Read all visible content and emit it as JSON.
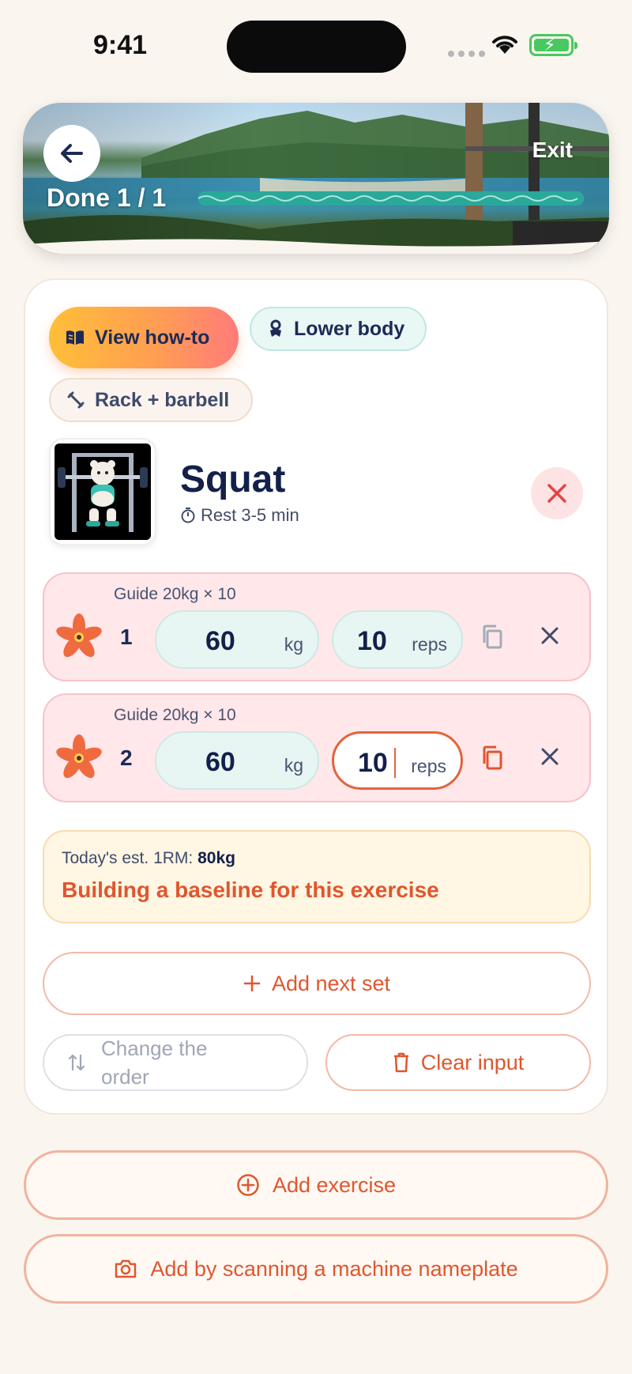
{
  "status_bar": {
    "time": "9:41"
  },
  "hero": {
    "back_icon": "arrow-left-icon",
    "exit_label": "Exit",
    "done_label": "Done 1 / 1",
    "progress_fraction": 1.0,
    "progress_color": "#2aa89a"
  },
  "chips": {
    "howto": {
      "label": "View how-to",
      "icon": "book-icon"
    },
    "lower": {
      "label": "Lower body",
      "icon": "muscle-icon"
    },
    "rack": {
      "label": "Rack + barbell",
      "icon": "dumbbell-icon"
    }
  },
  "exercise": {
    "name": "Squat",
    "rest": "Rest 3-5 min",
    "rest_icon": "timer-icon"
  },
  "sets": [
    {
      "number": "1",
      "guide": "Guide 20kg × 10",
      "weight": "60",
      "weight_unit": "kg",
      "reps": "10",
      "reps_unit": "reps"
    },
    {
      "number": "2",
      "guide": "Guide 20kg × 10",
      "weight": "60",
      "weight_unit": "kg",
      "reps": "10",
      "reps_unit": "reps"
    }
  ],
  "estimate": {
    "label": "Today's est. 1RM:",
    "value": "80kg",
    "message": "Building a baseline for this exercise"
  },
  "actions": {
    "add_next_set": "Add next set",
    "change_order": "Change the order",
    "clear_input": "Clear input",
    "add_exercise": "Add exercise",
    "scan": "Add by scanning a machine nameplate"
  },
  "colors": {
    "accent": "#e0562e",
    "navy": "#13204a",
    "set_bg": "#ffe7ea",
    "teal": "#2aa89a"
  }
}
